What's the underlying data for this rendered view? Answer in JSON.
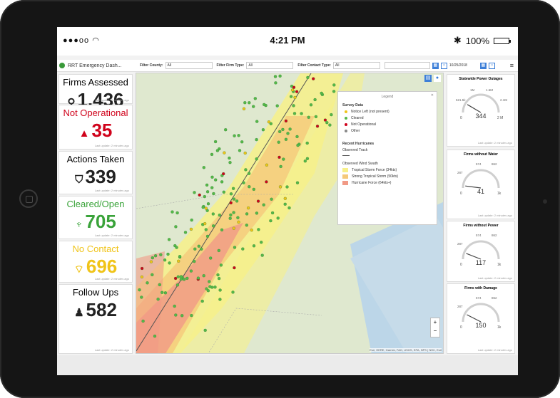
{
  "status_bar": {
    "signal": "●●●oo",
    "wifi": "wifi-icon",
    "time": "4:21 PM",
    "bluetooth": "✱",
    "battery": "100%"
  },
  "header": {
    "title": "RRT Emergency Dash...",
    "filter_county_label": "Filter County:",
    "filter_county_value": "All",
    "filter_firm_type_label": "Filter Firm Type:",
    "filter_firm_type_value": "All",
    "filter_contact_type_label": "Filter Contact Type:",
    "filter_contact_type_value": "All",
    "date": "10/25/2018"
  },
  "cards": [
    {
      "title": "Firms Assessed",
      "value": "1,436",
      "icon": "pin-icon",
      "glyph": "⚲",
      "color": "#222222",
      "update": "Last update: 2 minutes ago"
    },
    {
      "title": "Not Operational",
      "value": "35",
      "icon": "warning-icon",
      "glyph": "▲",
      "color": "#d0021b",
      "update": "Last update: 2 minutes ago"
    },
    {
      "title": "Actions Taken",
      "value": "339",
      "icon": "shield-icon",
      "glyph": "⛉",
      "color": "#222222",
      "update": "Last update: 2 minutes ago"
    },
    {
      "title": "Cleared/Open",
      "value": "705",
      "icon": "thumbs-up-icon",
      "glyph": "♆",
      "color": "#3aa33a",
      "update": "Last update: 2 minutes ago"
    },
    {
      "title": "No Contact",
      "value": "696",
      "icon": "no-signal-icon",
      "glyph": "⌔",
      "color": "#f0c419",
      "update": "Last update: 2 minutes ago"
    },
    {
      "title": "Follow Ups",
      "value": "582",
      "icon": "person-icon",
      "glyph": "♟",
      "color": "#222222",
      "update": "Last update: 2 minutes ago"
    }
  ],
  "legend": {
    "title": "Legend",
    "survey_heading": "Survey Data",
    "survey_items": [
      {
        "label": "Notice Left (not present)",
        "color": "#f0c419"
      },
      {
        "label": "Cleared",
        "color": "#55b849"
      },
      {
        "label": "Not Operational",
        "color": "#d0021b"
      },
      {
        "label": "Other",
        "color": "#888888"
      }
    ],
    "hurricanes_heading": "Recent Hurricanes",
    "observed_track": "Observed Track",
    "wind_swath_heading": "Observed Wind Swath",
    "swath_items": [
      {
        "label": "Tropical Storm Force (34kts)",
        "color": "#f7f08a"
      },
      {
        "label": "Strong Tropical Storm (50kts)",
        "color": "#f5c97a"
      },
      {
        "label": "Hurricane Force (64kts+)",
        "color": "#f19a86"
      }
    ]
  },
  "map": {
    "attribution": "Esri, HERE, Garmin, FAO, USGS, EPA, NPS | NHC, Esri"
  },
  "gauges": [
    {
      "title": "Statewide Power Outages",
      "value": "344",
      "min": "0",
      "max": "2 M",
      "ticks": [
        "521.5k",
        "1M",
        "1.6M",
        "2.1M"
      ],
      "update": "Last update: 2 minutes ago"
    },
    {
      "title": "Firms without Water",
      "value": "41",
      "min": "0",
      "max": "1k",
      "ticks": [
        "287",
        "574",
        "862"
      ],
      "update": "Last update: 2 minutes ago"
    },
    {
      "title": "Firms without Power",
      "value": "117",
      "min": "0",
      "max": "1k",
      "ticks": [
        "287",
        "574",
        "862"
      ],
      "update": "Last update: 2 minutes ago"
    },
    {
      "title": "Firms with Damage",
      "value": "150",
      "min": "0",
      "max": "1k",
      "ticks": [
        "287",
        "574",
        "862"
      ],
      "update": "Last update: 2 minutes ago"
    }
  ]
}
